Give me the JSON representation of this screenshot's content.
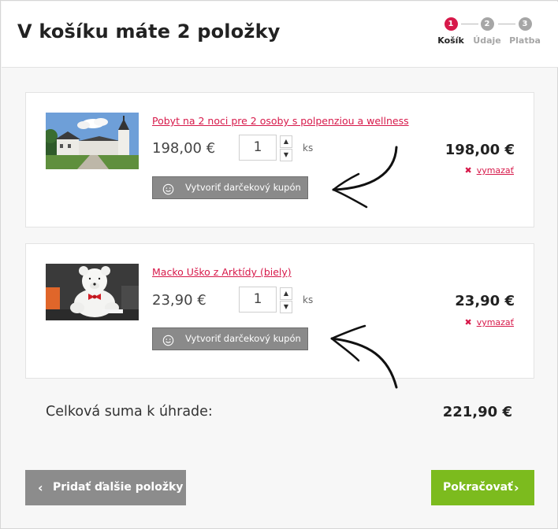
{
  "header": {
    "title": "V košíku máte 2 položky",
    "steps": [
      {
        "number": "1",
        "label": "Košík",
        "state": "active"
      },
      {
        "number": "2",
        "label": "Údaje",
        "state": "inactive"
      },
      {
        "number": "3",
        "label": "Platba",
        "state": "inactive"
      }
    ]
  },
  "cart": {
    "items": [
      {
        "name": "Pobyt na 2 noci pre 2 osoby s polpenziou a wellness",
        "unit_price": "198,00 €",
        "quantity": "1",
        "quantity_unit": "ks",
        "coupon_label": "Vytvoriť darčekový kupón",
        "total": "198,00 €",
        "remove_label": "vymazať"
      },
      {
        "name": "Macko Uško z Arktídy (biely)",
        "unit_price": "23,90 €",
        "quantity": "1",
        "quantity_unit": "ks",
        "coupon_label": "Vytvoriť darčekový kupón",
        "total": "23,90 €",
        "remove_label": "vymazať"
      }
    ]
  },
  "summary": {
    "label": "Celková suma k úhrade:",
    "total": "221,90 €"
  },
  "actions": {
    "back_label": "Pridať ďalšie položky",
    "next_label": "Pokračovať"
  },
  "icons": {
    "stepper_up": "▲",
    "stepper_down": "▼",
    "remove": "✖",
    "chevron_left": "‹",
    "chevron_right": "›"
  },
  "colors": {
    "accent": "#d7194a",
    "primary_button": "#7cbb1e",
    "secondary_button": "#8c8c8c",
    "step_inactive": "#a6a6a6"
  }
}
